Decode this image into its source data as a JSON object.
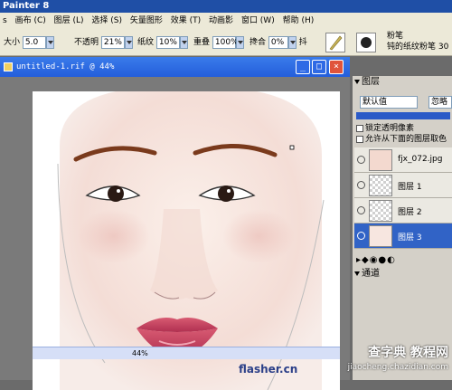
{
  "app": {
    "title": "Painter 8"
  },
  "menu": [
    "s",
    "画布 (C)",
    "图层 (L)",
    "选择 (S)",
    "矢量图形",
    "效果 (T)",
    "动画影",
    "窗口 (W)",
    "帮助 (H)"
  ],
  "props": {
    "size_label": "大小",
    "size_value": "5.0",
    "opacity_label": "不透明",
    "opacity_value": "21%",
    "grain_label": "纸纹",
    "grain_value": "10%",
    "overlap_label": "重叠",
    "overlap_value": "100%",
    "blend_label": "搀合",
    "blend_value": "0%",
    "extra_label": "抖",
    "brush_name": "粉笔",
    "brush_variant": "钝的纸纹粉笔 30"
  },
  "document": {
    "title": "untitled-1.rif @ 44%",
    "zoom": "44%",
    "watermark": "flasher.cn"
  },
  "layers_panel": {
    "title": "图层",
    "composite": "默认值",
    "ignore": "忽略",
    "checkbox1": "锁定透明像素",
    "checkbox2": "允许从下面的图层取色",
    "layers": [
      {
        "name": "fjx_072.jpg"
      },
      {
        "name": "图层 1"
      },
      {
        "name": "图层 2"
      },
      {
        "name": "图层 3"
      }
    ],
    "channels": "通道"
  },
  "site_watermark": {
    "cn": "查字典 教程网",
    "url": "jiaocheng.chazidian.com"
  },
  "colors": {
    "selected_layer": "#3163c6",
    "doc_title": "#245edb",
    "lips": "#c8475f"
  }
}
